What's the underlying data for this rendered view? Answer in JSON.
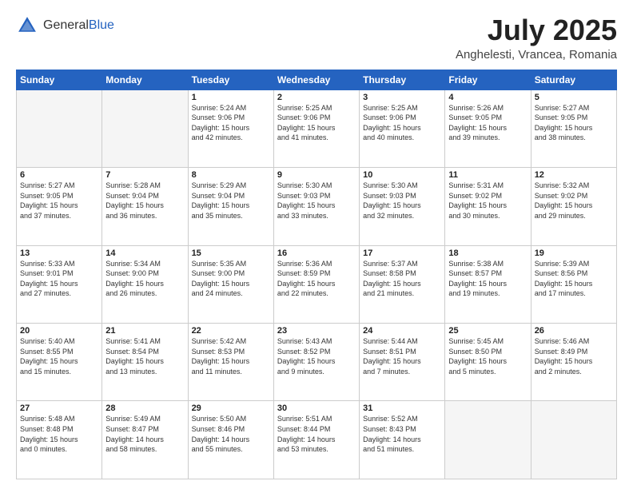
{
  "header": {
    "logo_general": "General",
    "logo_blue": "Blue",
    "month": "July 2025",
    "location": "Anghelesti, Vrancea, Romania"
  },
  "days_of_week": [
    "Sunday",
    "Monday",
    "Tuesday",
    "Wednesday",
    "Thursday",
    "Friday",
    "Saturday"
  ],
  "weeks": [
    [
      {
        "day": "",
        "info": ""
      },
      {
        "day": "",
        "info": ""
      },
      {
        "day": "1",
        "info": "Sunrise: 5:24 AM\nSunset: 9:06 PM\nDaylight: 15 hours\nand 42 minutes."
      },
      {
        "day": "2",
        "info": "Sunrise: 5:25 AM\nSunset: 9:06 PM\nDaylight: 15 hours\nand 41 minutes."
      },
      {
        "day": "3",
        "info": "Sunrise: 5:25 AM\nSunset: 9:06 PM\nDaylight: 15 hours\nand 40 minutes."
      },
      {
        "day": "4",
        "info": "Sunrise: 5:26 AM\nSunset: 9:05 PM\nDaylight: 15 hours\nand 39 minutes."
      },
      {
        "day": "5",
        "info": "Sunrise: 5:27 AM\nSunset: 9:05 PM\nDaylight: 15 hours\nand 38 minutes."
      }
    ],
    [
      {
        "day": "6",
        "info": "Sunrise: 5:27 AM\nSunset: 9:05 PM\nDaylight: 15 hours\nand 37 minutes."
      },
      {
        "day": "7",
        "info": "Sunrise: 5:28 AM\nSunset: 9:04 PM\nDaylight: 15 hours\nand 36 minutes."
      },
      {
        "day": "8",
        "info": "Sunrise: 5:29 AM\nSunset: 9:04 PM\nDaylight: 15 hours\nand 35 minutes."
      },
      {
        "day": "9",
        "info": "Sunrise: 5:30 AM\nSunset: 9:03 PM\nDaylight: 15 hours\nand 33 minutes."
      },
      {
        "day": "10",
        "info": "Sunrise: 5:30 AM\nSunset: 9:03 PM\nDaylight: 15 hours\nand 32 minutes."
      },
      {
        "day": "11",
        "info": "Sunrise: 5:31 AM\nSunset: 9:02 PM\nDaylight: 15 hours\nand 30 minutes."
      },
      {
        "day": "12",
        "info": "Sunrise: 5:32 AM\nSunset: 9:02 PM\nDaylight: 15 hours\nand 29 minutes."
      }
    ],
    [
      {
        "day": "13",
        "info": "Sunrise: 5:33 AM\nSunset: 9:01 PM\nDaylight: 15 hours\nand 27 minutes."
      },
      {
        "day": "14",
        "info": "Sunrise: 5:34 AM\nSunset: 9:00 PM\nDaylight: 15 hours\nand 26 minutes."
      },
      {
        "day": "15",
        "info": "Sunrise: 5:35 AM\nSunset: 9:00 PM\nDaylight: 15 hours\nand 24 minutes."
      },
      {
        "day": "16",
        "info": "Sunrise: 5:36 AM\nSunset: 8:59 PM\nDaylight: 15 hours\nand 22 minutes."
      },
      {
        "day": "17",
        "info": "Sunrise: 5:37 AM\nSunset: 8:58 PM\nDaylight: 15 hours\nand 21 minutes."
      },
      {
        "day": "18",
        "info": "Sunrise: 5:38 AM\nSunset: 8:57 PM\nDaylight: 15 hours\nand 19 minutes."
      },
      {
        "day": "19",
        "info": "Sunrise: 5:39 AM\nSunset: 8:56 PM\nDaylight: 15 hours\nand 17 minutes."
      }
    ],
    [
      {
        "day": "20",
        "info": "Sunrise: 5:40 AM\nSunset: 8:55 PM\nDaylight: 15 hours\nand 15 minutes."
      },
      {
        "day": "21",
        "info": "Sunrise: 5:41 AM\nSunset: 8:54 PM\nDaylight: 15 hours\nand 13 minutes."
      },
      {
        "day": "22",
        "info": "Sunrise: 5:42 AM\nSunset: 8:53 PM\nDaylight: 15 hours\nand 11 minutes."
      },
      {
        "day": "23",
        "info": "Sunrise: 5:43 AM\nSunset: 8:52 PM\nDaylight: 15 hours\nand 9 minutes."
      },
      {
        "day": "24",
        "info": "Sunrise: 5:44 AM\nSunset: 8:51 PM\nDaylight: 15 hours\nand 7 minutes."
      },
      {
        "day": "25",
        "info": "Sunrise: 5:45 AM\nSunset: 8:50 PM\nDaylight: 15 hours\nand 5 minutes."
      },
      {
        "day": "26",
        "info": "Sunrise: 5:46 AM\nSunset: 8:49 PM\nDaylight: 15 hours\nand 2 minutes."
      }
    ],
    [
      {
        "day": "27",
        "info": "Sunrise: 5:48 AM\nSunset: 8:48 PM\nDaylight: 15 hours\nand 0 minutes."
      },
      {
        "day": "28",
        "info": "Sunrise: 5:49 AM\nSunset: 8:47 PM\nDaylight: 14 hours\nand 58 minutes."
      },
      {
        "day": "29",
        "info": "Sunrise: 5:50 AM\nSunset: 8:46 PM\nDaylight: 14 hours\nand 55 minutes."
      },
      {
        "day": "30",
        "info": "Sunrise: 5:51 AM\nSunset: 8:44 PM\nDaylight: 14 hours\nand 53 minutes."
      },
      {
        "day": "31",
        "info": "Sunrise: 5:52 AM\nSunset: 8:43 PM\nDaylight: 14 hours\nand 51 minutes."
      },
      {
        "day": "",
        "info": ""
      },
      {
        "day": "",
        "info": ""
      }
    ]
  ]
}
